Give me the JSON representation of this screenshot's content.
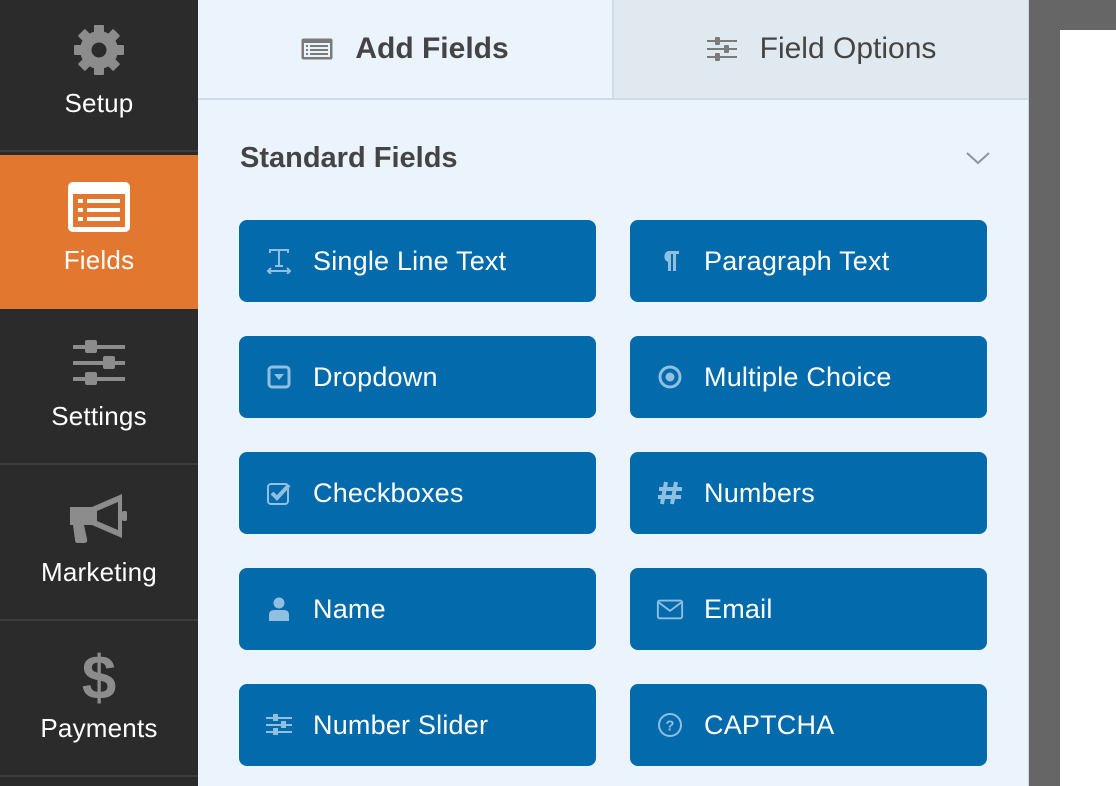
{
  "sidebar": {
    "items": [
      {
        "label": "Setup",
        "icon": "gear-icon",
        "active": false
      },
      {
        "label": "Fields",
        "icon": "fields-list-icon",
        "active": true
      },
      {
        "label": "Settings",
        "icon": "sliders-icon",
        "active": false
      },
      {
        "label": "Marketing",
        "icon": "megaphone-icon",
        "active": false
      },
      {
        "label": "Payments",
        "icon": "dollar-icon",
        "active": false
      }
    ]
  },
  "tabs": [
    {
      "label": "Add Fields",
      "icon": "list-icon",
      "active": true
    },
    {
      "label": "Field Options",
      "icon": "sliders-icon",
      "active": false
    }
  ],
  "section": {
    "title": "Standard Fields",
    "collapse_icon": "chevron-down-icon"
  },
  "fields": [
    {
      "label": "Single Line Text",
      "icon": "text-icon"
    },
    {
      "label": "Paragraph Text",
      "icon": "paragraph-icon"
    },
    {
      "label": "Dropdown",
      "icon": "dropdown-icon"
    },
    {
      "label": "Multiple Choice",
      "icon": "radio-icon"
    },
    {
      "label": "Checkboxes",
      "icon": "checkbox-icon"
    },
    {
      "label": "Numbers",
      "icon": "hash-icon"
    },
    {
      "label": "Name",
      "icon": "user-icon"
    },
    {
      "label": "Email",
      "icon": "envelope-icon"
    },
    {
      "label": "Number Slider",
      "icon": "slider-icon"
    },
    {
      "label": "CAPTCHA",
      "icon": "question-circle-icon"
    }
  ],
  "colors": {
    "sidebar_bg": "#2b2b2b",
    "active_nav": "#e27730",
    "panel_bg": "#ebf3fc",
    "field_button": "#036aab",
    "icon_muted": "#8c8c8c"
  }
}
